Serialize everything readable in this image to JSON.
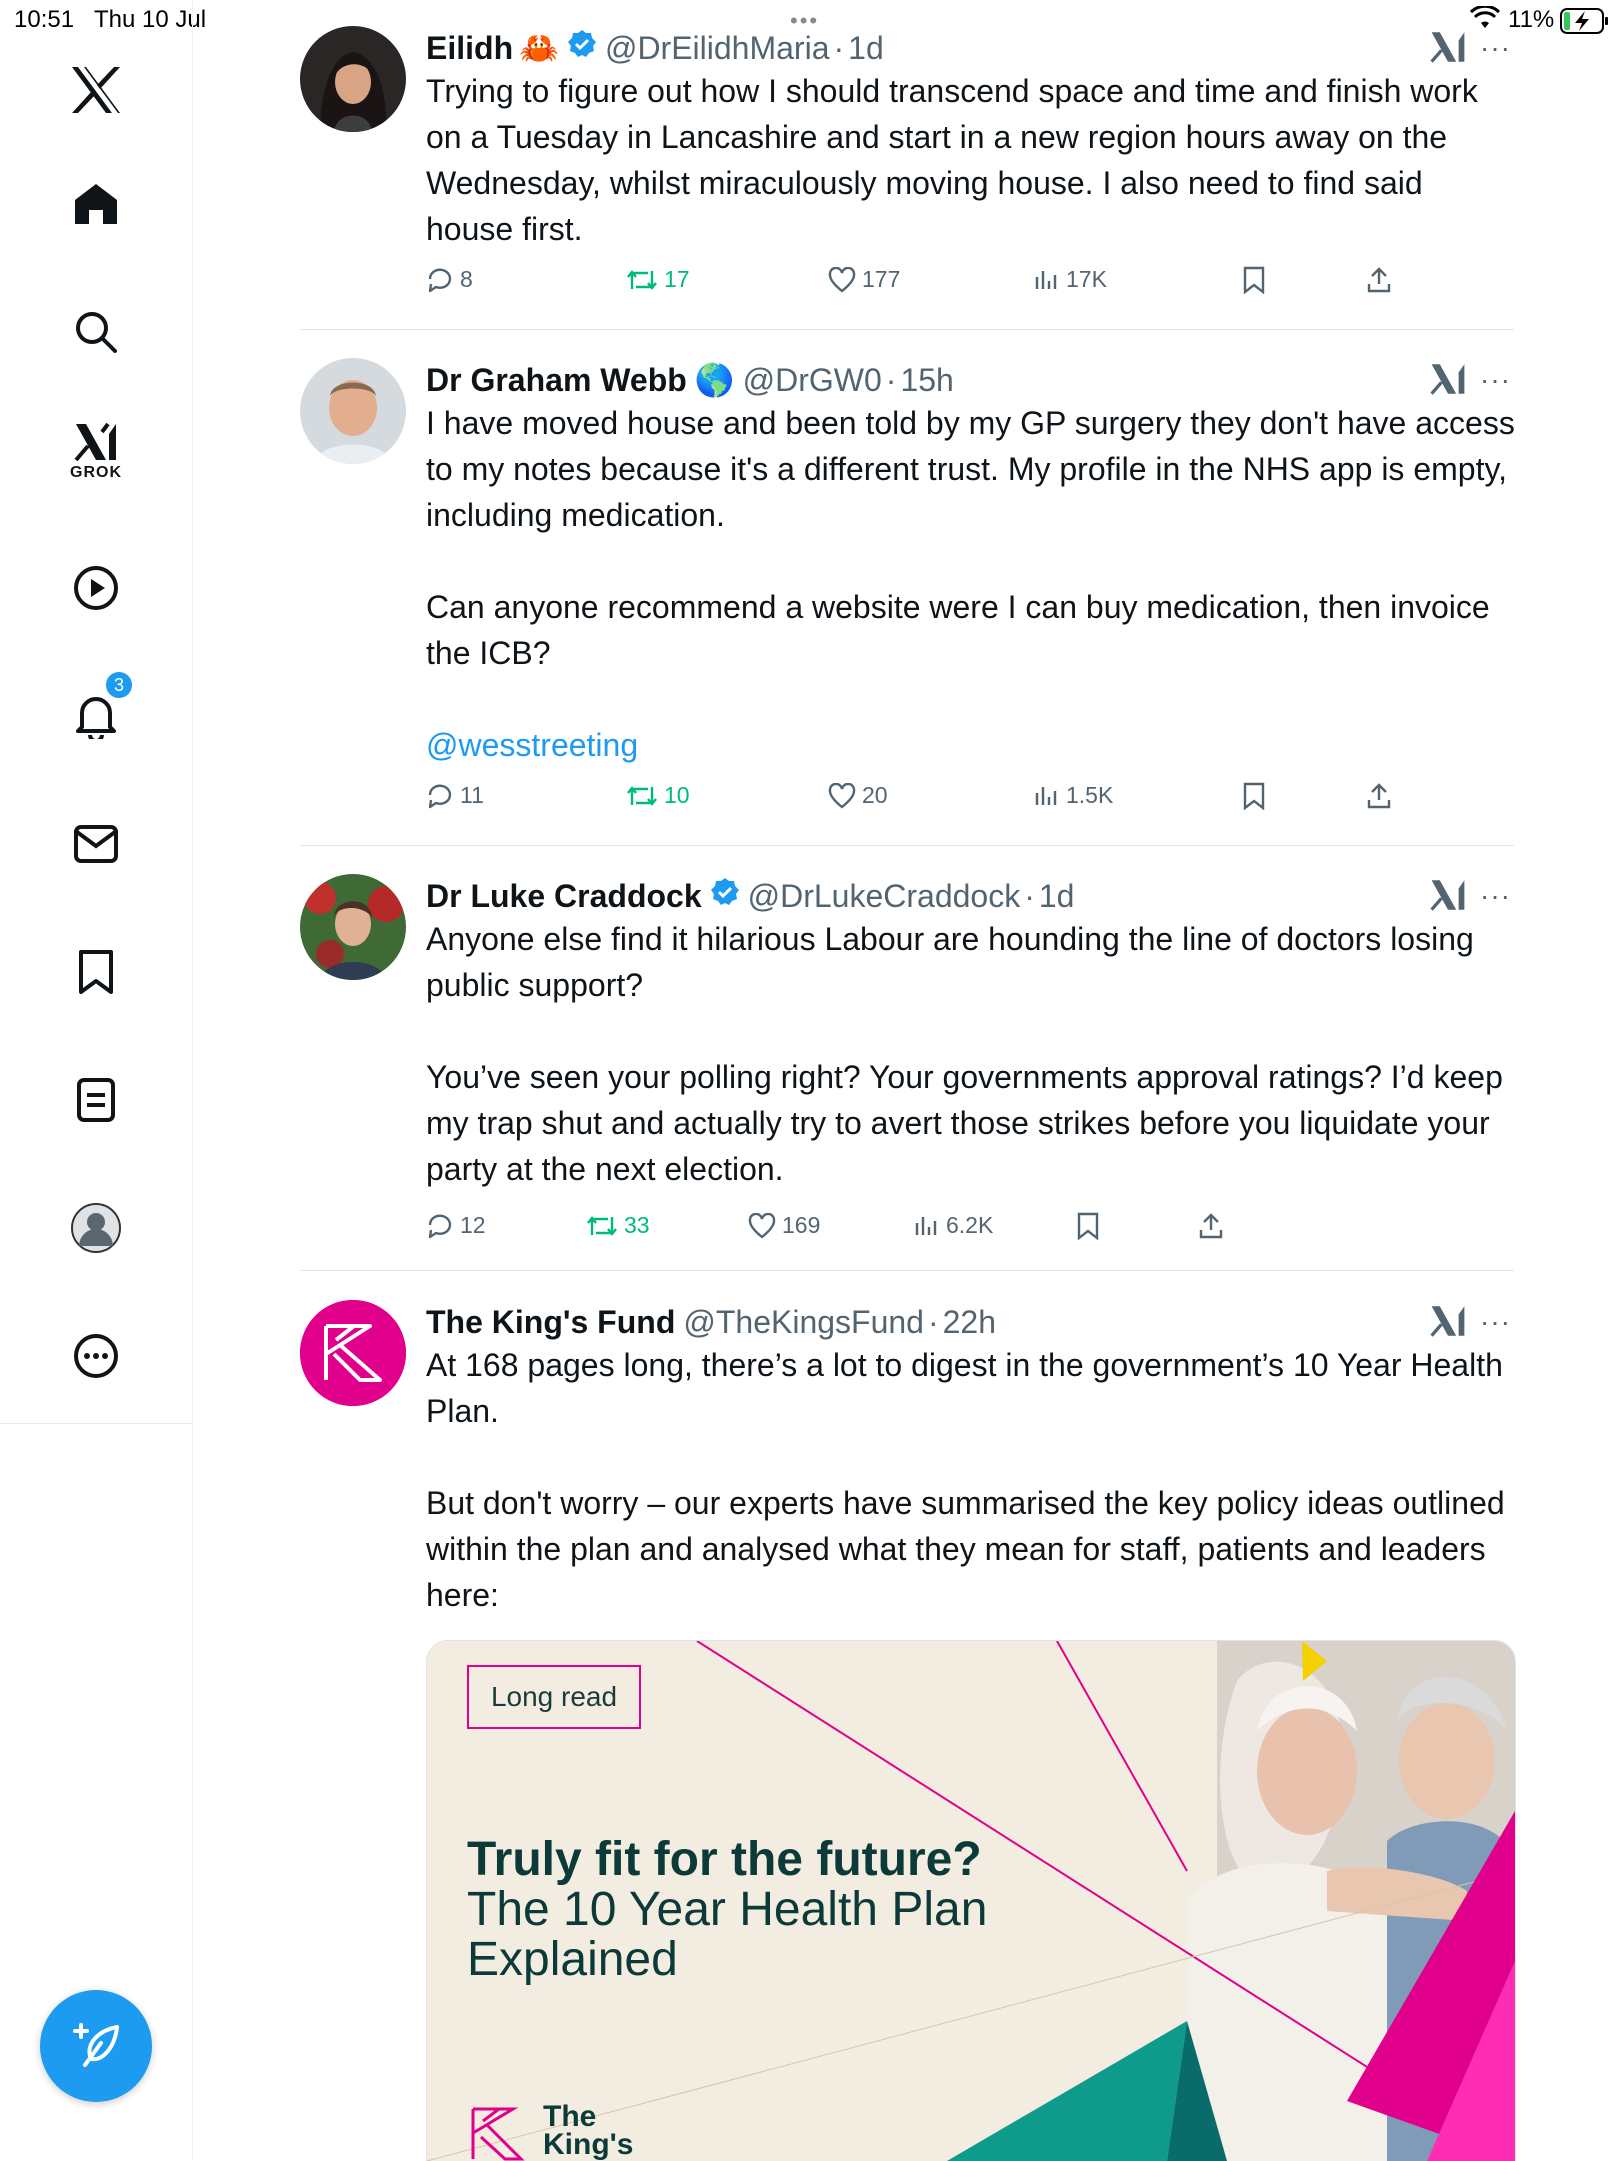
{
  "status_bar": {
    "time": "10:51",
    "date": "Thu 10 Jul",
    "battery": "11%"
  },
  "sidebar": {
    "grok_label": "GROK",
    "notifications_badge": "3",
    "items": [
      "x-logo",
      "home",
      "explore",
      "grok",
      "video",
      "notifications",
      "messages",
      "bookmarks",
      "lists",
      "profile",
      "more"
    ]
  },
  "tweets": [
    {
      "name": "Eilidh",
      "emoji": "🦀",
      "handle": "@DrEilidhMaria",
      "time": "1d",
      "verified": true,
      "paragraphs": [
        "Trying to figure out how I should transcend space and time and finish work on a Tuesday in Lancashire and start in a new region hours away on the Wednesday, whilst miraculously moving house.  I also need to find said house first."
      ],
      "replies": "8",
      "reposts": "17",
      "likes": "177",
      "views": "17K"
    },
    {
      "name": "Dr Graham Webb",
      "emoji": "🌎",
      "handle": "@DrGW0",
      "time": "15h",
      "verified": false,
      "paragraphs": [
        "I have moved house and been told by my GP surgery they don't have access to my notes because it's a different trust. My profile in the NHS app is empty, including medication.",
        "Can anyone recommend a website were I can buy medication, then invoice the ICB?"
      ],
      "mention": "@wesstreeting",
      "replies": "11",
      "reposts": "10",
      "likes": "20",
      "views": "1.5K"
    },
    {
      "name": "Dr Luke Craddock",
      "handle": "@DrLukeCraddock",
      "time": "1d",
      "verified": true,
      "paragraphs": [
        "Anyone else find it hilarious Labour are hounding the line of doctors losing public support?",
        "You’ve seen your polling right? Your governments approval ratings? I’d keep my trap shut and actually try to avert those strikes before you liquidate your party at the next election."
      ],
      "replies": "12",
      "reposts": "33",
      "likes": "169",
      "views": "6.2K"
    },
    {
      "name": "The King's Fund",
      "handle": "@TheKingsFund",
      "time": "22h",
      "verified": false,
      "paragraphs": [
        "At 168 pages long, there’s a lot to digest in the government’s 10 Year Health Plan.",
        "But don't worry – our experts have summarised the key policy ideas outlined within the plan and analysed what they mean for staff, patients and leaders here:"
      ],
      "card": {
        "tag": "Long read",
        "title_bold": "Truly fit for the future?",
        "title_rest": " The 10 Year Health Plan Explained",
        "logo_line1": "The",
        "logo_line2": "King's"
      }
    }
  ],
  "colors": {
    "accent": "#1d9bf0",
    "repost": "#00ba7c",
    "muted": "#536471",
    "kings_fund": "#e0008c"
  }
}
